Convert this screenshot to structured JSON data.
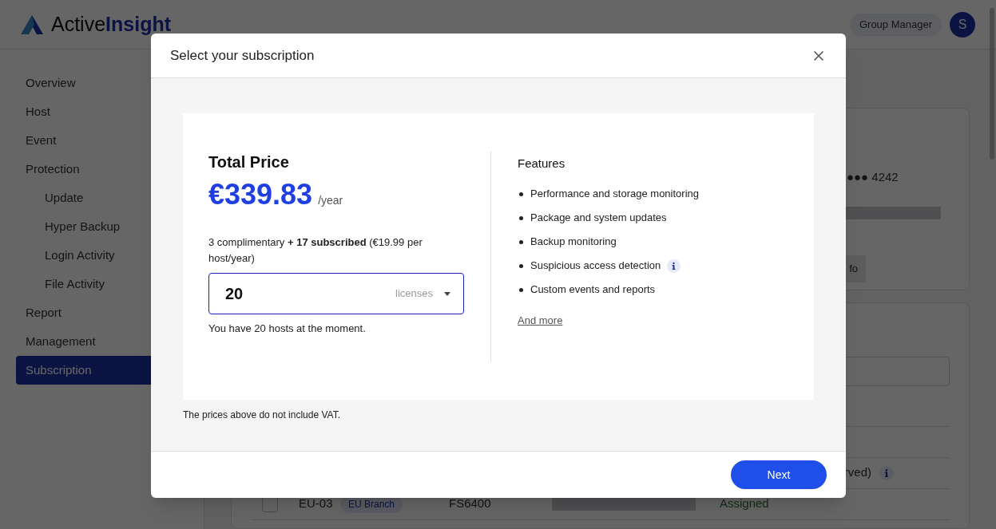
{
  "header": {
    "logo_part_1": "Active",
    "logo_part_2": "Insight",
    "role": "Group Manager",
    "avatar": "S"
  },
  "sidebar": {
    "items": [
      {
        "label": "Overview",
        "selected": false
      },
      {
        "label": "Host",
        "selected": false
      },
      {
        "label": "Event",
        "selected": false
      },
      {
        "label": "Protection",
        "selected": false,
        "children": [
          {
            "label": "Update",
            "selected": false
          },
          {
            "label": "Hyper Backup",
            "selected": false
          },
          {
            "label": "Login Activity",
            "selected": false
          },
          {
            "label": "File Activity",
            "selected": false
          }
        ]
      },
      {
        "label": "Report",
        "selected": false
      },
      {
        "label": "Management",
        "selected": false
      },
      {
        "label": "Subscription",
        "selected": true
      }
    ]
  },
  "background": {
    "card_number": "●●● 4242",
    "button": "fo",
    "note": "rved)",
    "table_row": {
      "checked": false,
      "id": "EU-03",
      "tag": "EU Branch",
      "model": "FS6400",
      "status": "Assigned"
    }
  },
  "dialog": {
    "title": "Select your subscription",
    "total_price_label": "Total Price",
    "price": "€339.83",
    "period": "/year",
    "breakdown": "3 complimentary **+ 17 subscribed** (€19.99 per host/year)",
    "licenses": {
      "value": "20",
      "unit": "licenses"
    },
    "hosts_note": "You have 20 hosts at the moment.",
    "features_title": "Features",
    "features": [
      {
        "text": "Performance and storage monitoring",
        "info": false
      },
      {
        "text": "Package and system updates",
        "info": false
      },
      {
        "text": "Backup monitoring",
        "info": false
      },
      {
        "text": "Suspicious access detection",
        "info": true
      },
      {
        "text": "Custom events and reports",
        "info": false
      }
    ],
    "more_link": "And more",
    "vat_note": "The prices above do not include VAT.",
    "next_button": "Next"
  }
}
